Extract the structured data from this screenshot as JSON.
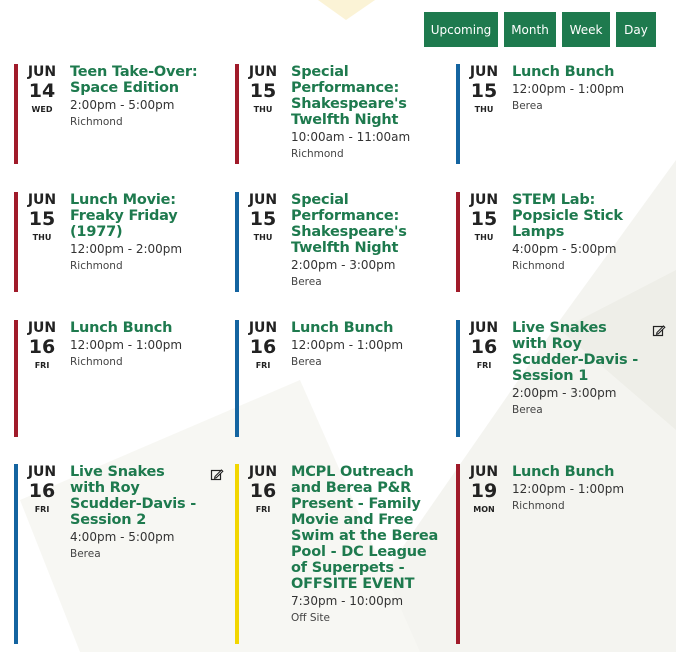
{
  "colors": {
    "accent": "#1e7a4e",
    "red": "#a01b2a",
    "blue": "#1464a0",
    "yellow": "#f2d600"
  },
  "view_buttons": [
    {
      "label": "Upcoming",
      "name": "upcoming-view-button"
    },
    {
      "label": "Month",
      "name": "month-view-button"
    },
    {
      "label": "Week",
      "name": "week-view-button"
    },
    {
      "label": "Day",
      "name": "day-view-button"
    }
  ],
  "events": [
    {
      "mon": "JUN",
      "day": "14",
      "dow": "WED",
      "title": "Teen Take-Over: Space Edition",
      "time": "2:00pm - 5:00pm",
      "location": "Richmond",
      "bar": "red",
      "editable": false
    },
    {
      "mon": "JUN",
      "day": "15",
      "dow": "THU",
      "title": "Special Performance: Shakespeare's Twelfth Night",
      "time": "10:00am - 11:00am",
      "location": "Richmond",
      "bar": "red",
      "editable": false
    },
    {
      "mon": "JUN",
      "day": "15",
      "dow": "THU",
      "title": "Lunch Bunch",
      "time": "12:00pm - 1:00pm",
      "location": "Berea",
      "bar": "blue",
      "editable": false
    },
    {
      "mon": "JUN",
      "day": "15",
      "dow": "THU",
      "title": "Lunch Movie: Freaky Friday (1977)",
      "time": "12:00pm - 2:00pm",
      "location": "Richmond",
      "bar": "red",
      "editable": false
    },
    {
      "mon": "JUN",
      "day": "15",
      "dow": "THU",
      "title": "Special Performance: Shakespeare's Twelfth Night",
      "time": "2:00pm - 3:00pm",
      "location": "Berea",
      "bar": "blue",
      "editable": false
    },
    {
      "mon": "JUN",
      "day": "15",
      "dow": "THU",
      "title": "STEM Lab: Popsicle Stick Lamps",
      "time": "4:00pm - 5:00pm",
      "location": "Richmond",
      "bar": "red",
      "editable": false
    },
    {
      "mon": "JUN",
      "day": "16",
      "dow": "FRI",
      "title": "Lunch Bunch",
      "time": "12:00pm - 1:00pm",
      "location": "Richmond",
      "bar": "red",
      "editable": false
    },
    {
      "mon": "JUN",
      "day": "16",
      "dow": "FRI",
      "title": "Lunch Bunch",
      "time": "12:00pm - 1:00pm",
      "location": "Berea",
      "bar": "blue",
      "editable": false
    },
    {
      "mon": "JUN",
      "day": "16",
      "dow": "FRI",
      "title": "Live Snakes with Roy Scudder-Davis - Session 1",
      "time": "2:00pm - 3:00pm",
      "location": "Berea",
      "bar": "blue",
      "editable": true
    },
    {
      "mon": "JUN",
      "day": "16",
      "dow": "FRI",
      "title": "Live Snakes with Roy Scudder-Davis - Session 2",
      "time": "4:00pm - 5:00pm",
      "location": "Berea",
      "bar": "blue",
      "editable": true
    },
    {
      "mon": "JUN",
      "day": "16",
      "dow": "FRI",
      "title": "MCPL Outreach and Berea P&R Present - Family Movie and Free Swim at the Berea Pool - DC League of Superpets - OFFSITE EVENT",
      "time": "7:30pm - 10:00pm",
      "location": "Off Site",
      "bar": "yellow",
      "editable": false
    },
    {
      "mon": "JUN",
      "day": "19",
      "dow": "MON",
      "title": "Lunch Bunch",
      "time": "12:00pm - 1:00pm",
      "location": "Richmond",
      "bar": "red",
      "editable": false
    }
  ]
}
